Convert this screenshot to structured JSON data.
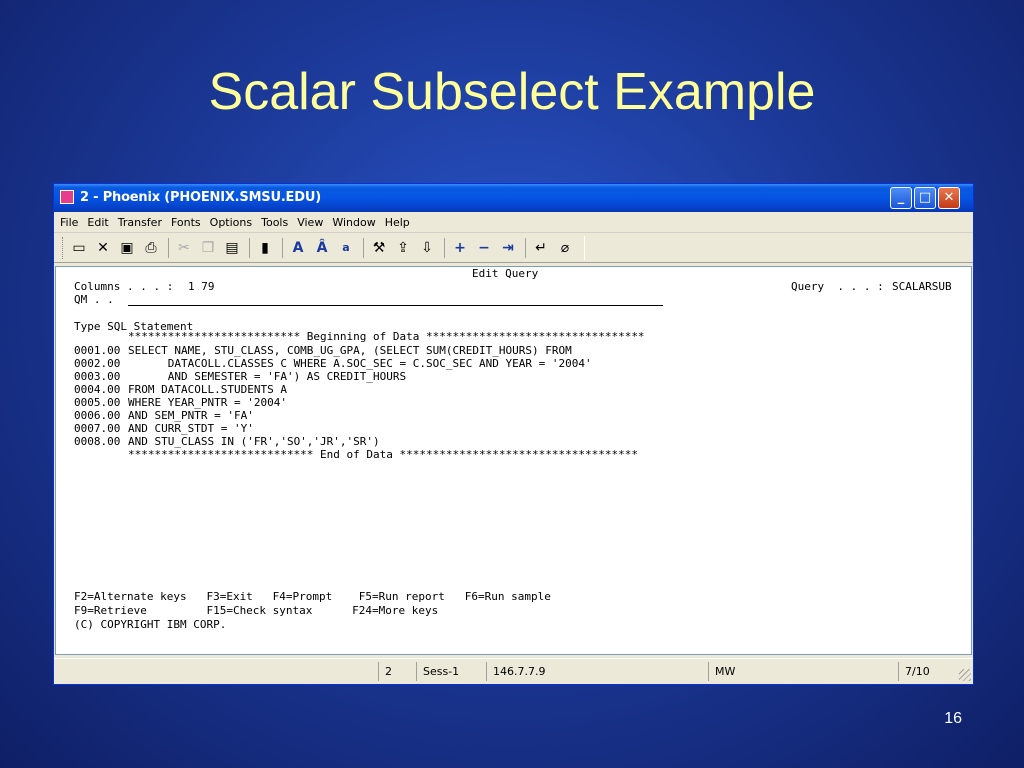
{
  "slide": {
    "title": "Scalar Subselect Example",
    "page_number": "16"
  },
  "window": {
    "title": "2 - Phoenix (PHOENIX.SMSU.EDU)",
    "controls": {
      "minimize": "_",
      "maximize": "□",
      "close": "✕"
    }
  },
  "menu": [
    "File",
    "Edit",
    "Transfer",
    "Fonts",
    "Options",
    "Tools",
    "View",
    "Window",
    "Help"
  ],
  "toolbar_icons": [
    "disk-icon",
    "close-icon",
    "save-icon",
    "print-icon",
    "cut-icon",
    "copy-icon",
    "paste-icon",
    "macro-icon",
    "font-icon",
    "font-larger-icon",
    "font-smaller-icon",
    "tools-icon",
    "send-icon",
    "receive-icon",
    "plus-icon",
    "minus-icon",
    "tab-icon",
    "enter-icon",
    "eraser-icon"
  ],
  "screen": {
    "header_center": "Edit Query",
    "columns_label": "Columns . . . :",
    "columns_value": "1 79",
    "query_label": "Query  . . . :",
    "query_value": "SCALARSUB",
    "qm_label": "QM . .",
    "type_label": "Type SQL Statement",
    "begin_marker": "************************** Beginning of Data *********************************",
    "lines": [
      {
        "num": "0001.00",
        "text": "SELECT NAME, STU_CLASS, COMB_UG_GPA, (SELECT SUM(CREDIT_HOURS) FROM"
      },
      {
        "num": "0002.00",
        "text": "      DATACOLL.CLASSES C WHERE A.SOC_SEC = C.SOC_SEC AND YEAR = '2004'"
      },
      {
        "num": "0003.00",
        "text": "      AND SEMESTER = 'FA') AS CREDIT_HOURS"
      },
      {
        "num": "0004.00",
        "text": "FROM DATACOLL.STUDENTS A"
      },
      {
        "num": "0005.00",
        "text": "WHERE YEAR_PNTR = '2004'"
      },
      {
        "num": "0006.00",
        "text": "AND SEM_PNTR = 'FA'"
      },
      {
        "num": "0007.00",
        "text": "AND CURR_STDT = 'Y'"
      },
      {
        "num": "0008.00",
        "text": "AND STU_CLASS IN ('FR','SO','JR','SR')"
      }
    ],
    "end_marker": "**************************** End of Data ************************************",
    "fkeys_row1": "F2=Alternate keys   F3=Exit   F4=Prompt    F5=Run report   F6=Run sample",
    "fkeys_row2": "F9=Retrieve         F15=Check syntax      F24=More keys",
    "copyright": "(C) COPYRIGHT IBM CORP."
  },
  "status": {
    "session_num": "2",
    "session": "Sess-1",
    "ip": "146.7.7.9",
    "mode": "MW",
    "cursor": "7/10"
  }
}
